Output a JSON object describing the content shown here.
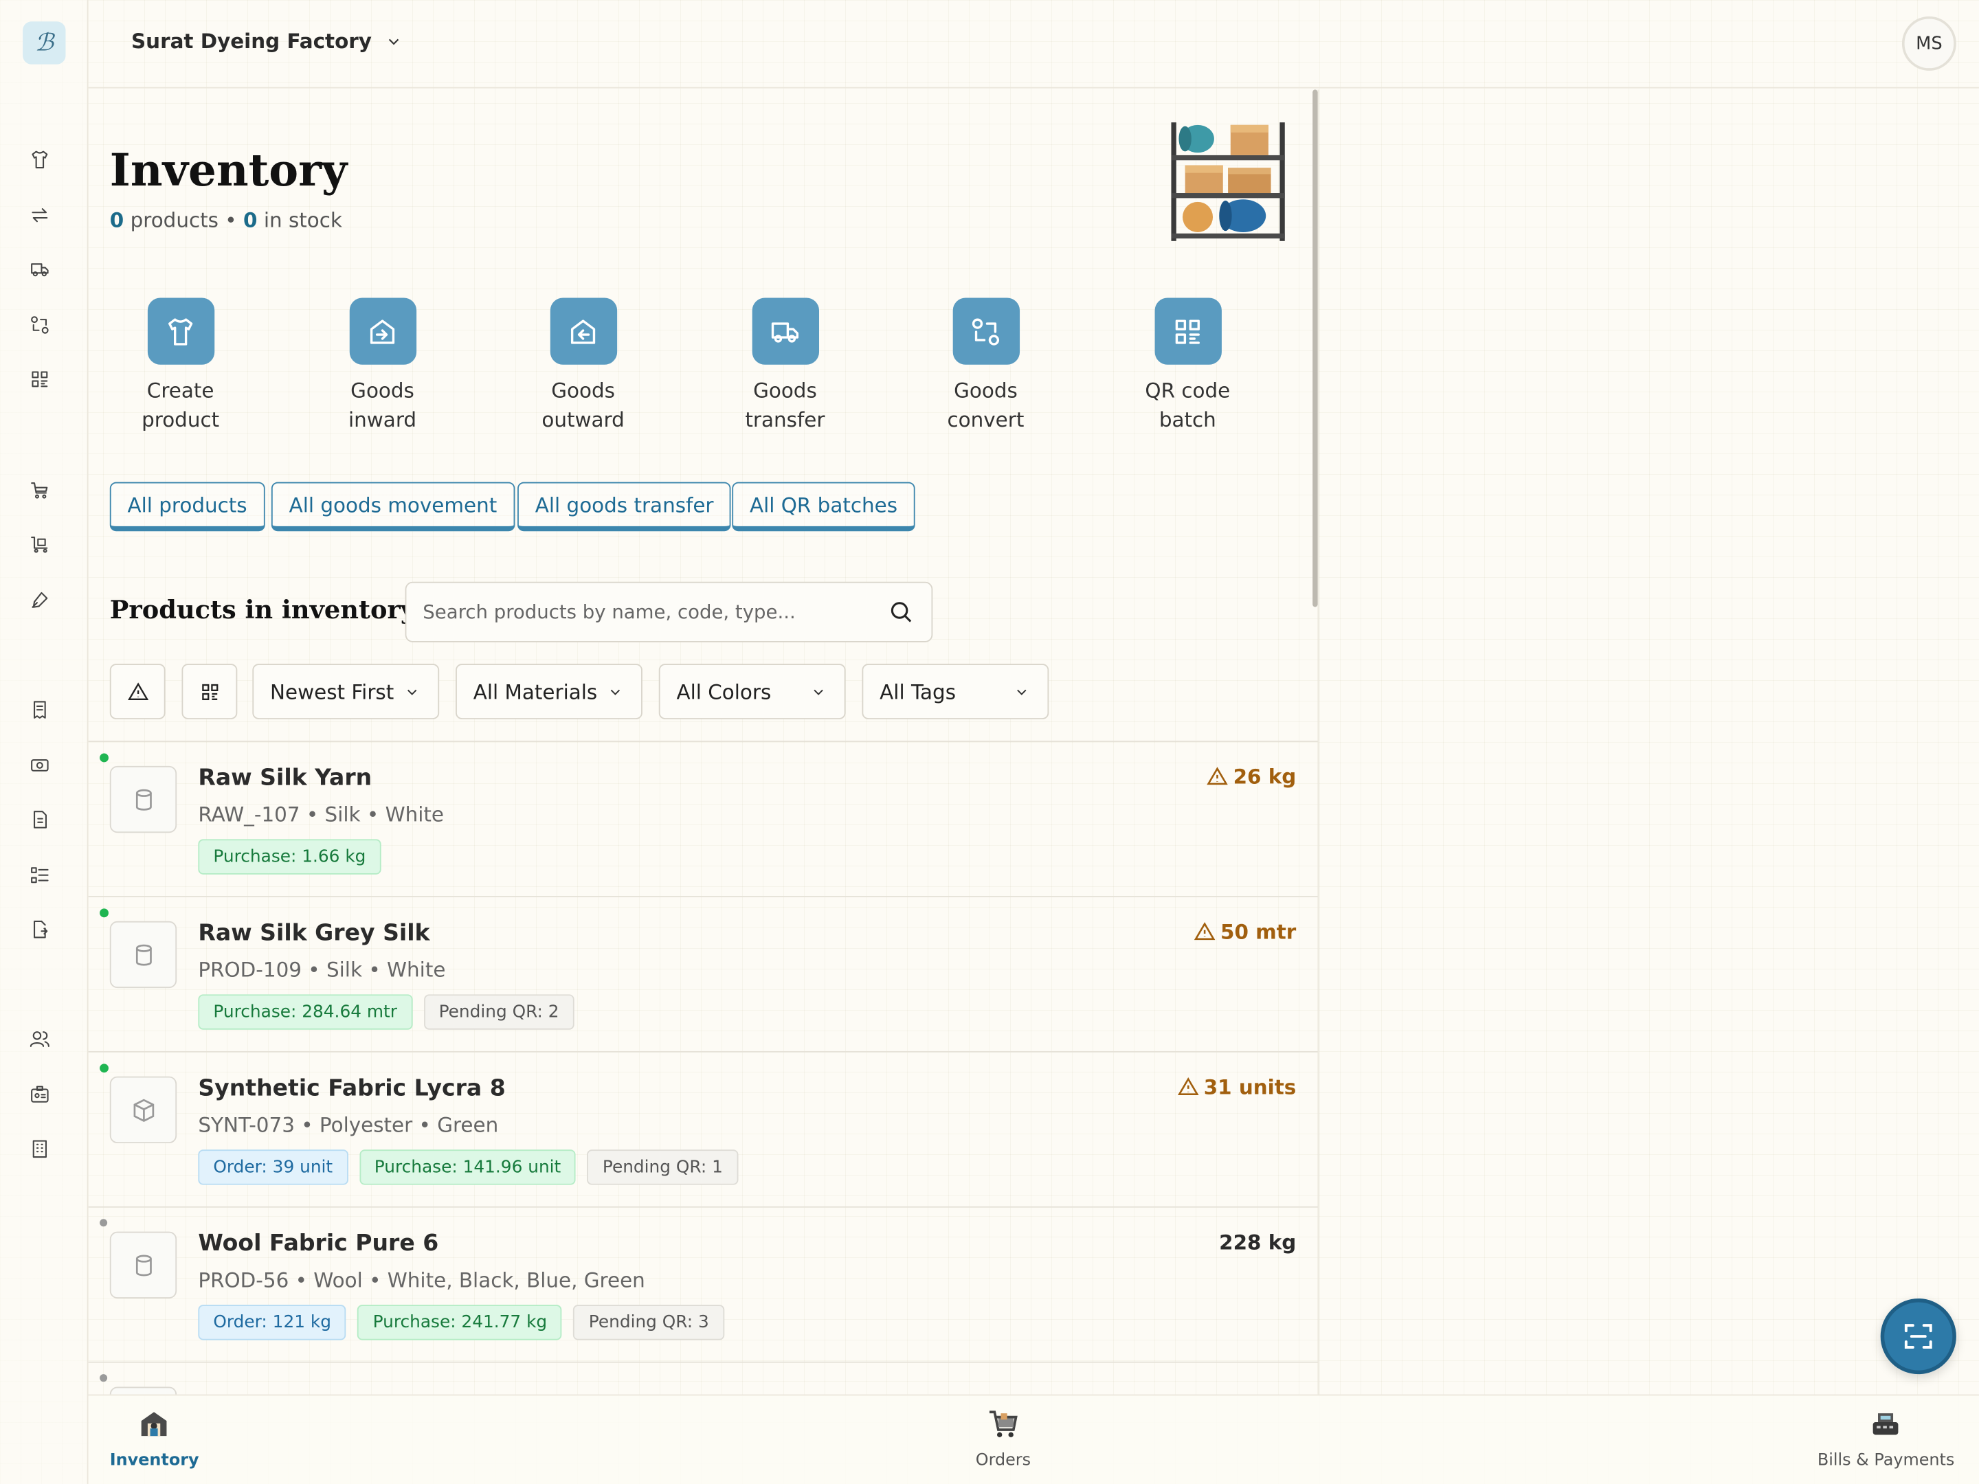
{
  "header": {
    "factory_name": "Surat Dyeing Factory",
    "avatar_initials": "MS"
  },
  "page": {
    "title": "Inventory",
    "product_count": "0",
    "products_label": "products",
    "separator": "•",
    "stock_count": "0",
    "stock_label": "in stock"
  },
  "actions": [
    {
      "line1": "Create",
      "line2": "product",
      "icon": "shirt-icon"
    },
    {
      "line1": "Goods",
      "line2": "inward",
      "icon": "inward-icon"
    },
    {
      "line1": "Goods",
      "line2": "outward",
      "icon": "outward-icon"
    },
    {
      "line1": "Goods",
      "line2": "transfer",
      "icon": "truck-icon"
    },
    {
      "line1": "Goods",
      "line2": "convert",
      "icon": "convert-icon"
    },
    {
      "line1": "QR code",
      "line2": "batch",
      "icon": "qr-icon"
    }
  ],
  "links": [
    "All products",
    "All goods movement",
    "All goods transfer",
    "All QR batches"
  ],
  "products_section": {
    "title": "Products in inventory",
    "search_placeholder": "Search products by name, code, type..."
  },
  "filters": {
    "sort": "Newest First",
    "materials": "All Materials",
    "colors": "All Colors",
    "tags": "All Tags"
  },
  "products": [
    {
      "name": "Raw Silk Yarn",
      "meta": "RAW_-107 • Silk • White",
      "quantity": "26 kg",
      "low_stock": true,
      "active": true,
      "icon": "cylinder-icon",
      "tags": [
        {
          "type": "purchase",
          "label": "Purchase: 1.66 kg"
        }
      ]
    },
    {
      "name": "Raw Silk Grey Silk",
      "meta": "PROD-109 • Silk • White",
      "quantity": "50 mtr",
      "low_stock": true,
      "active": true,
      "icon": "cylinder-icon",
      "tags": [
        {
          "type": "purchase",
          "label": "Purchase: 284.64 mtr"
        },
        {
          "type": "pending",
          "label": "Pending QR: 2"
        }
      ]
    },
    {
      "name": "Synthetic Fabric Lycra 8",
      "meta": "SYNT-073 • Polyester • Green",
      "quantity": "31 units",
      "low_stock": true,
      "active": true,
      "icon": "box-icon",
      "tags": [
        {
          "type": "order",
          "label": "Order: 39 unit"
        },
        {
          "type": "purchase",
          "label": "Purchase: 141.96 unit"
        },
        {
          "type": "pending",
          "label": "Pending QR: 1"
        }
      ]
    },
    {
      "name": "Wool Fabric Pure 6",
      "meta": "PROD-56 • Wool • White, Black, Blue, Green",
      "quantity": "228 kg",
      "low_stock": false,
      "active": false,
      "icon": "cylinder-icon",
      "tags": [
        {
          "type": "order",
          "label": "Order: 121 kg"
        },
        {
          "type": "purchase",
          "label": "Purchase: 241.77 kg"
        },
        {
          "type": "pending",
          "label": "Pending QR: 3"
        }
      ]
    }
  ],
  "bottom_nav": [
    {
      "label": "Inventory",
      "active": true
    },
    {
      "label": "Orders",
      "active": false
    },
    {
      "label": "Bills & Payments",
      "active": false
    }
  ],
  "colors": {
    "accent": "#2d7aa8",
    "action_tile": "#5a9bc0",
    "warning": "#a15f0e",
    "active_dot": "#1fb551",
    "inactive_dot": "#9a9a9a"
  }
}
